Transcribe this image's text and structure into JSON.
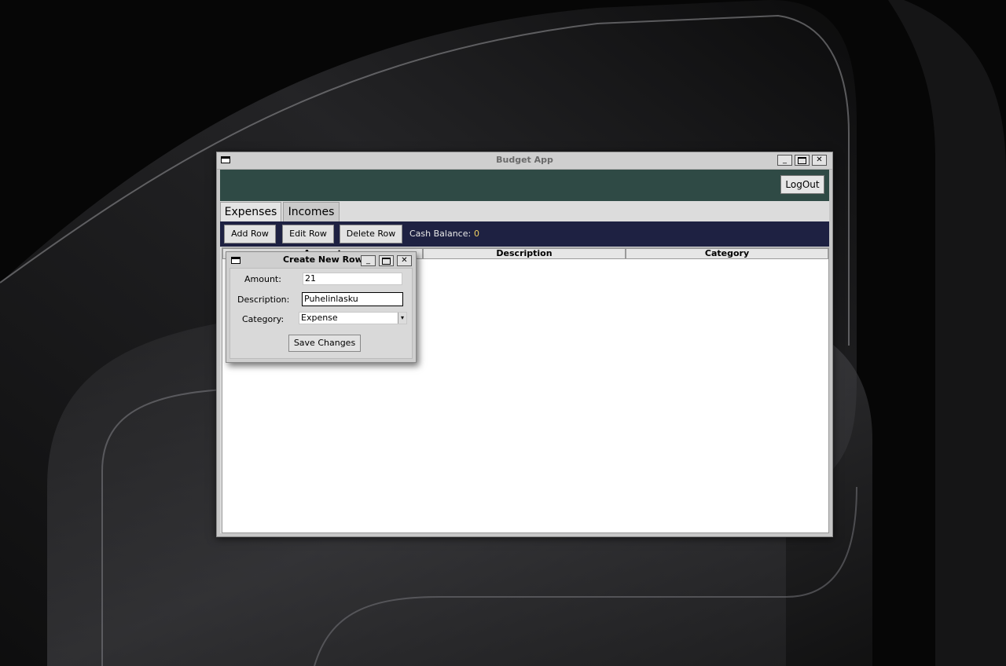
{
  "window": {
    "title": "Budget App",
    "minimize_glyph": "_",
    "close_glyph": "✕"
  },
  "header": {
    "logout_label": "LogOut"
  },
  "tabs": [
    {
      "label": "Expenses",
      "active": true
    },
    {
      "label": "Incomes",
      "active": false
    }
  ],
  "toolbar": {
    "add_label": "Add Row",
    "edit_label": "Edit Row",
    "delete_label": "Delete Row",
    "cash_label": "Cash Balance:",
    "cash_value": "0"
  },
  "table": {
    "columns": [
      "Amount",
      "Description",
      "Category"
    ],
    "rows": []
  },
  "dialog": {
    "title": "Create New Row",
    "amount_label": "Amount:",
    "amount_value": "21",
    "description_label": "Description:",
    "description_value": "Puhelinlasku",
    "category_label": "Category:",
    "category_value": "Expense",
    "save_label": "Save Changes"
  },
  "colors": {
    "header_band": "#2f4a45",
    "toolbar_band": "#1e2142",
    "cash_value": "#f0d060"
  }
}
